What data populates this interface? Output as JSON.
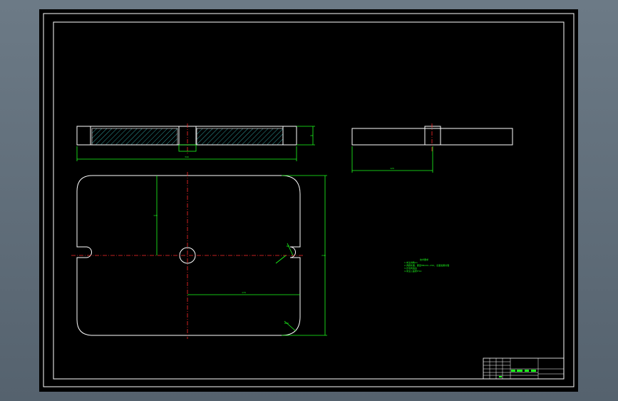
{
  "drawing": {
    "title": "",
    "notes_heading": "技术要求",
    "notes": [
      "1.未注倒角C1",
      "2.调质处理，硬度HB220~250，表面发黑处理",
      "3.去毛刺锐边",
      "4.未注公差按IT14"
    ],
    "dimensions": {
      "side_length": "340",
      "side_height": "20",
      "end_width": "120",
      "plan_width": "340",
      "plan_height": "240",
      "half_height": "120",
      "half_width": "170",
      "slot_width": "R8",
      "corner_radius": "R20"
    },
    "title_block": {
      "scale_label": "",
      "drawing_no": ""
    }
  },
  "colors": {
    "outline": "#ffffff",
    "dimension": "#1dff1d",
    "centerline": "#ff2a2a",
    "hatch": "#3cc7c7",
    "frame": "#ffffff"
  }
}
